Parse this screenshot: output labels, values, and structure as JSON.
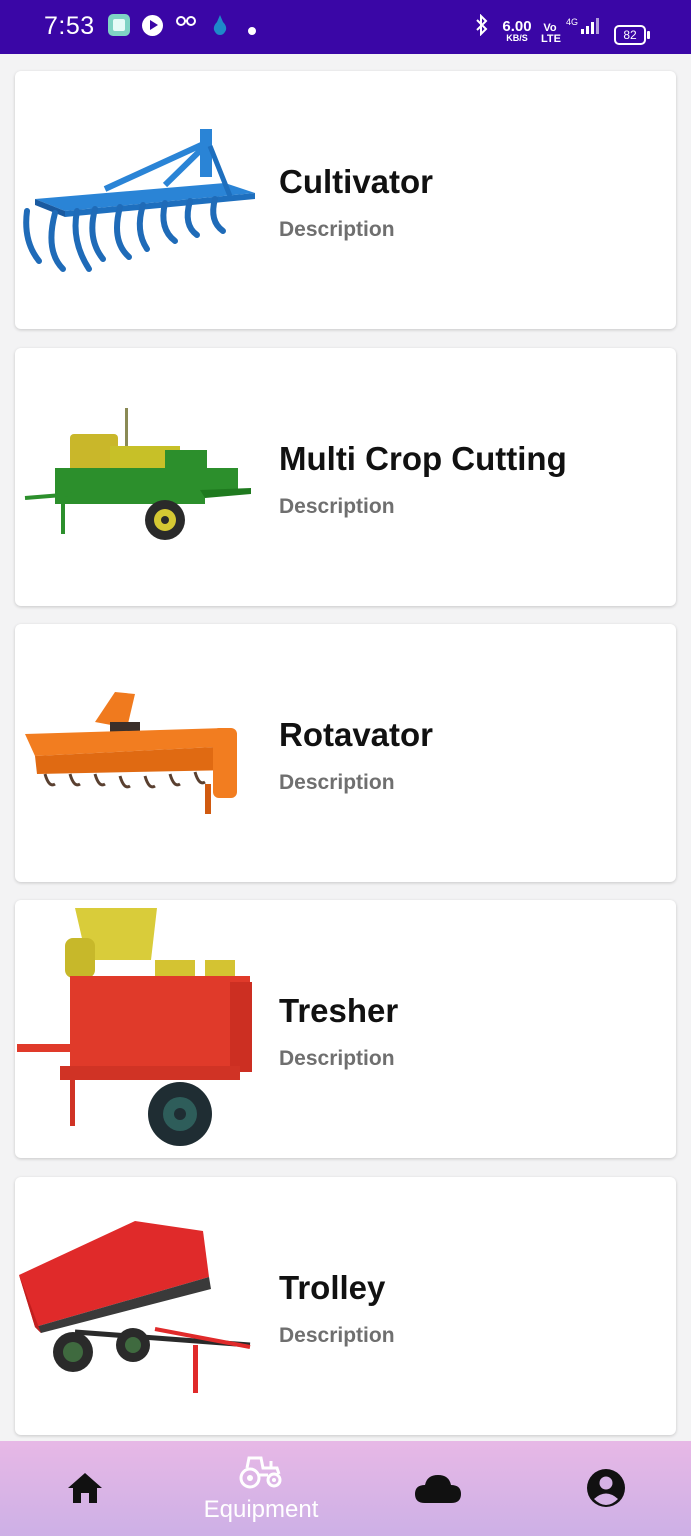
{
  "status_bar": {
    "time": "7:53",
    "net_speed": "6.00",
    "net_unit": "KB/S",
    "volte": "Vo LTE",
    "network": "4G",
    "battery": "82"
  },
  "equipment": [
    {
      "name": "Cultivator",
      "description": "Description",
      "image": "cultivator-image"
    },
    {
      "name": "Multi Crop Cutting",
      "description": "Description",
      "image": "multi-crop-cutter-image"
    },
    {
      "name": "Rotavator",
      "description": "Description",
      "image": "rotavator-image"
    },
    {
      "name": "Tresher",
      "description": "Description",
      "image": "thresher-image"
    },
    {
      "name": "Trolley",
      "description": "Description",
      "image": "trolley-image"
    }
  ],
  "bottom_nav": {
    "items": [
      {
        "icon": "home-icon",
        "label": ""
      },
      {
        "icon": "tractor-icon",
        "label": "Equipment",
        "selected": true
      },
      {
        "icon": "cloud-icon",
        "label": ""
      },
      {
        "icon": "account-icon",
        "label": ""
      }
    ]
  },
  "colors": {
    "status_bar": "#3a06a6",
    "nav_gradient_top": "#e7b8e6",
    "nav_gradient_bottom": "#cdb0e6",
    "title": "#111111",
    "description": "#6f6f6f"
  }
}
